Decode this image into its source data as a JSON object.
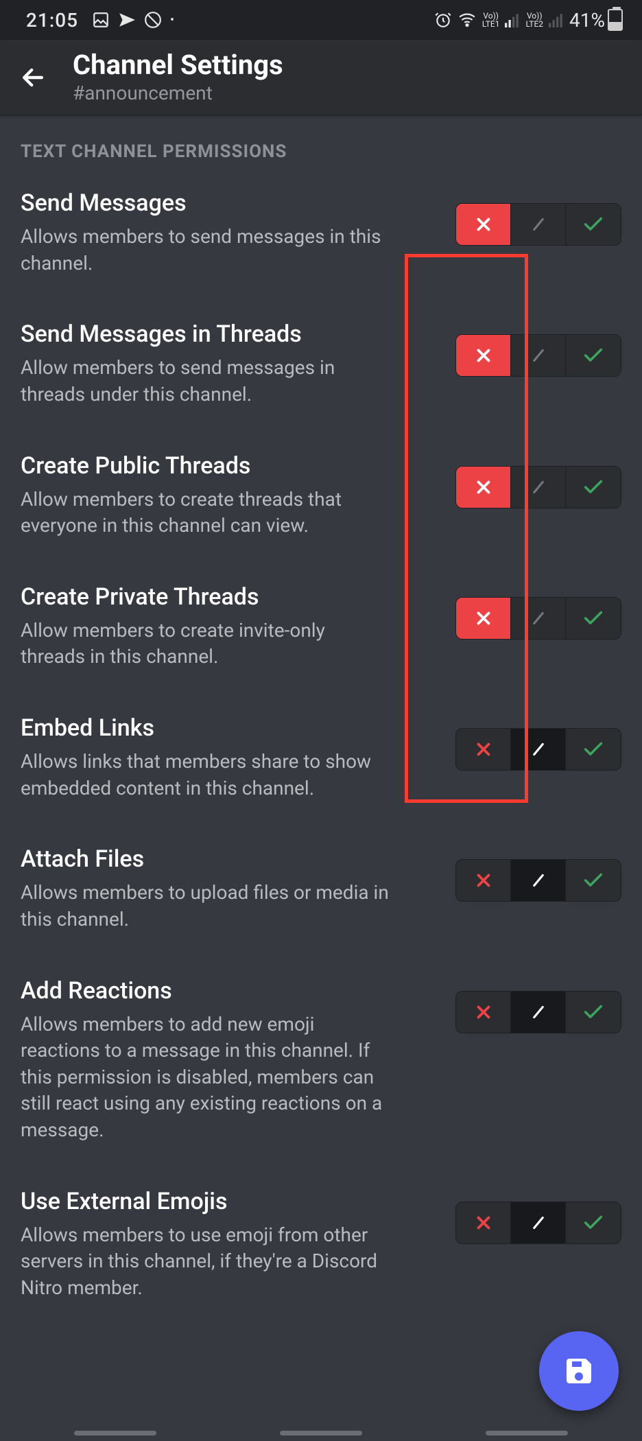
{
  "status": {
    "time": "21:05",
    "battery_pct": "41%",
    "lte1": "LTE1",
    "lte2": "LTE2",
    "vo1": "Vo))",
    "vo2": "Vo))"
  },
  "header": {
    "title": "Channel Settings",
    "subtitle": "#announcement"
  },
  "section_label": "TEXT CHANNEL PERMISSIONS",
  "permissions": [
    {
      "title": "Send Messages",
      "desc": "Allows members to send messages in this channel.",
      "state": "deny"
    },
    {
      "title": "Send Messages in Threads",
      "desc": "Allow members to send messages in threads under this channel.",
      "state": "deny"
    },
    {
      "title": "Create Public Threads",
      "desc": "Allow members to create threads that everyone in this channel can view.",
      "state": "deny"
    },
    {
      "title": "Create Private Threads",
      "desc": "Allow members to create invite-only threads in this channel.",
      "state": "deny"
    },
    {
      "title": "Embed Links",
      "desc": "Allows links that members share to show embedded content in this channel.",
      "state": "neutral"
    },
    {
      "title": "Attach Files",
      "desc": "Allows members to upload files or media in this channel.",
      "state": "neutral"
    },
    {
      "title": "Add Reactions",
      "desc": "Allows members to add new emoji reactions to a message in this channel. If this permission is disabled, members can still react using any existing reactions on a message.",
      "state": "neutral"
    },
    {
      "title": "Use External Emojis",
      "desc": "Allows members to use emoji from other servers in this channel, if they're a Discord Nitro member.",
      "state": "neutral"
    }
  ],
  "annotation": {
    "highlight_permission_indices": [
      0,
      1,
      2,
      3
    ],
    "highlighted_segment": "deny"
  }
}
